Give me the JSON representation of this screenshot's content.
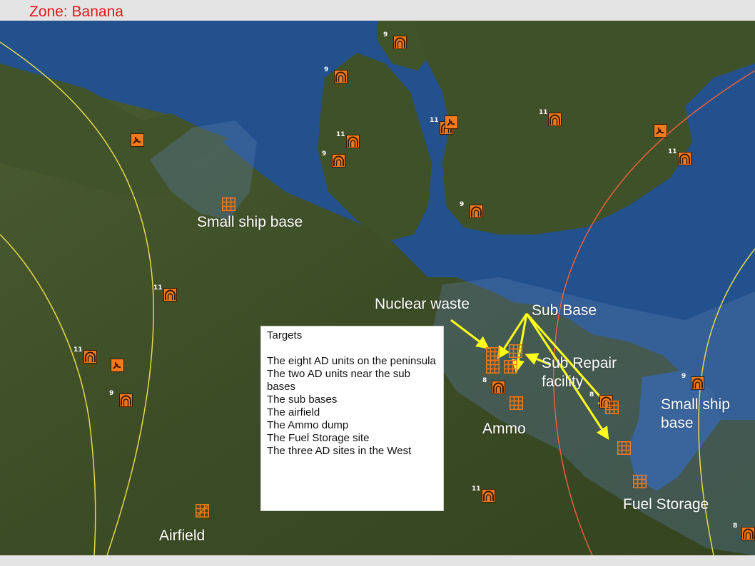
{
  "zone": {
    "title": "Zone: Banana"
  },
  "targets": {
    "title": "Targets",
    "items": [
      "The eight AD units on the peninsula",
      "The two AD units near the sub bases",
      "The sub bases",
      "The airfield",
      "The Ammo dump",
      "The Fuel Storage site",
      "The three AD sites in the West"
    ]
  },
  "labels": {
    "small_ship_base_west": "Small ship base",
    "nuclear_waste": "Nuclear waste",
    "sub_base": "Sub Base",
    "sub_repair_line1": "Sub Repair",
    "sub_repair_line2": "facility",
    "small_ship_base_east_line1": "Small ship",
    "small_ship_base_east_line2": "base",
    "ammo": "Ammo",
    "fuel_storage": "Fuel Storage",
    "airfield": "Airfield"
  },
  "unit_numbers": [
    "9",
    "9",
    "11",
    "9",
    "11",
    "11",
    "11",
    "9",
    "11",
    "11",
    "9",
    "8",
    "8",
    "9",
    "11",
    "8"
  ],
  "colors": {
    "zone_title": "#e8141e",
    "land": "#3f5128",
    "water": "#23518e",
    "symbol": "#f07a1e",
    "arrow": "#ffff1a",
    "range_yellow": "#e6d84a",
    "range_red": "#e8603c"
  },
  "icons": {
    "sam_site": "sam-site-icon",
    "radar": "radar-icon",
    "facility": "facility-grid-icon",
    "airfield": "airfield-icon"
  }
}
